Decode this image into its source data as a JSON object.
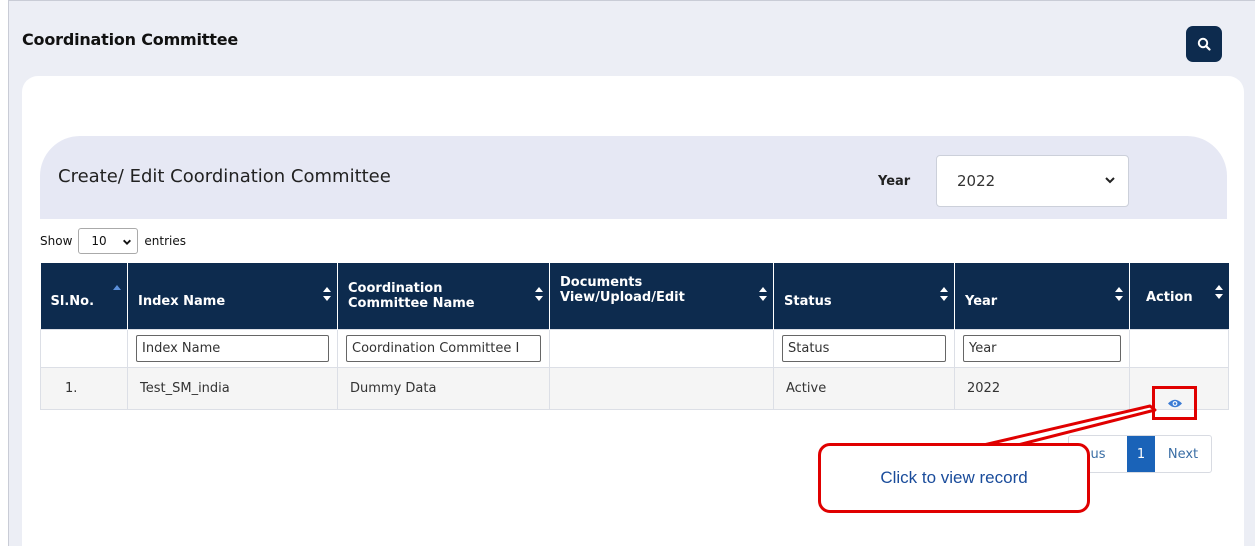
{
  "page": {
    "title": "Coordination Committee"
  },
  "section": {
    "title": "Create/ Edit Coordination Committee",
    "year_label": "Year",
    "year_value": "2022"
  },
  "length": {
    "prefix": "Show",
    "value": "10",
    "suffix": "entries"
  },
  "table": {
    "headers": {
      "slno": "Sl.No.",
      "index_name": "Index Name",
      "committee_line1": "Coordination",
      "committee_line2": "Committee Name",
      "documents_line1": "Documents",
      "documents_line2": "View/Upload/Edit",
      "status": "Status",
      "year": "Year",
      "action": "Action"
    },
    "filters": {
      "index_name": "Index Name",
      "committee": "Coordination Committee I",
      "status": "Status",
      "year": "Year"
    },
    "rows": [
      {
        "slno": "1.",
        "index_name": "Test_SM_india",
        "committee": "Dummy Data",
        "documents": "",
        "status": "Active",
        "year": "2022"
      }
    ]
  },
  "pagination": {
    "previous": "us",
    "current": "1",
    "next": "Next"
  },
  "callout": {
    "text": "Click to view  record"
  },
  "colors": {
    "header": "#0d2b4e",
    "accent": "#1a63b8",
    "active": "#2e8b2e",
    "highlight": "#e00000"
  }
}
